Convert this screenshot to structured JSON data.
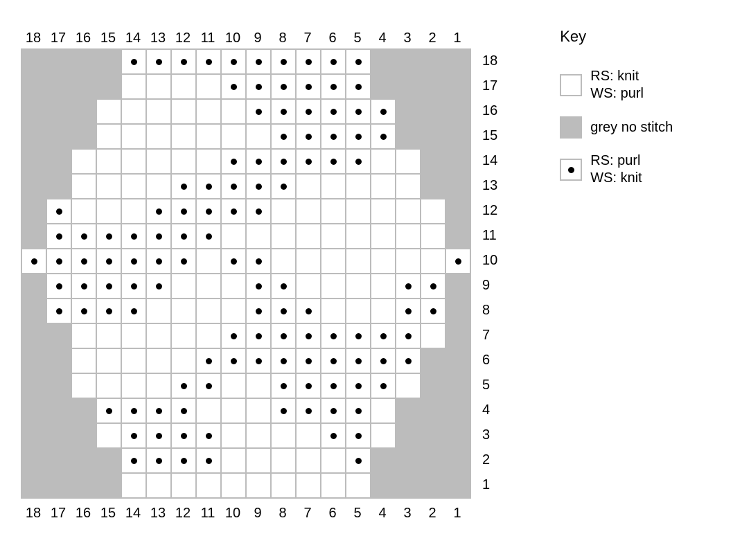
{
  "key": {
    "title": "Key",
    "items": [
      {
        "type": "knit",
        "lines": [
          "RS: knit",
          "WS: purl"
        ]
      },
      {
        "type": "nostitch",
        "lines": [
          "grey no stitch"
        ]
      },
      {
        "type": "purl",
        "lines": [
          "RS: purl",
          "WS: knit"
        ]
      }
    ]
  },
  "columns": [
    18,
    17,
    16,
    15,
    14,
    13,
    12,
    11,
    10,
    9,
    8,
    7,
    6,
    5,
    4,
    3,
    2,
    1
  ],
  "rows": [
    18,
    17,
    16,
    15,
    14,
    13,
    12,
    11,
    10,
    9,
    8,
    7,
    6,
    5,
    4,
    3,
    2,
    1
  ],
  "stitch_codes": {
    "0": "nostitch",
    "1": "knit",
    "2": "purl"
  },
  "grid": [
    [
      0,
      0,
      0,
      0,
      2,
      2,
      2,
      2,
      2,
      2,
      2,
      2,
      2,
      2,
      0,
      0,
      0,
      0
    ],
    [
      0,
      0,
      0,
      0,
      1,
      1,
      1,
      1,
      2,
      2,
      2,
      2,
      2,
      2,
      0,
      0,
      0,
      0
    ],
    [
      0,
      0,
      0,
      1,
      1,
      1,
      1,
      1,
      1,
      2,
      2,
      2,
      2,
      2,
      2,
      0,
      0,
      0
    ],
    [
      0,
      0,
      0,
      1,
      1,
      1,
      1,
      1,
      1,
      1,
      2,
      2,
      2,
      2,
      2,
      0,
      0,
      0
    ],
    [
      0,
      0,
      1,
      1,
      1,
      1,
      1,
      1,
      2,
      2,
      2,
      2,
      2,
      2,
      1,
      1,
      0,
      0
    ],
    [
      0,
      0,
      1,
      1,
      1,
      1,
      2,
      2,
      2,
      2,
      2,
      1,
      1,
      1,
      1,
      1,
      0,
      0
    ],
    [
      0,
      2,
      1,
      1,
      1,
      2,
      2,
      2,
      2,
      2,
      1,
      1,
      1,
      1,
      1,
      1,
      1,
      0
    ],
    [
      0,
      2,
      2,
      2,
      2,
      2,
      2,
      2,
      1,
      1,
      1,
      1,
      1,
      1,
      1,
      1,
      1,
      0
    ],
    [
      2,
      2,
      2,
      2,
      2,
      2,
      2,
      1,
      2,
      2,
      1,
      1,
      1,
      1,
      1,
      1,
      1,
      2
    ],
    [
      0,
      2,
      2,
      2,
      2,
      2,
      1,
      1,
      1,
      2,
      2,
      1,
      1,
      1,
      1,
      2,
      2,
      0
    ],
    [
      0,
      2,
      2,
      2,
      2,
      1,
      1,
      1,
      1,
      2,
      2,
      2,
      1,
      1,
      1,
      2,
      2,
      0
    ],
    [
      0,
      0,
      1,
      1,
      1,
      1,
      1,
      1,
      2,
      2,
      2,
      2,
      2,
      2,
      2,
      2,
      1,
      0
    ],
    [
      0,
      0,
      1,
      1,
      1,
      1,
      1,
      2,
      2,
      2,
      2,
      2,
      2,
      2,
      2,
      2,
      0,
      0
    ],
    [
      0,
      0,
      1,
      1,
      1,
      1,
      2,
      2,
      1,
      1,
      2,
      2,
      2,
      2,
      2,
      1,
      0,
      0
    ],
    [
      0,
      0,
      0,
      2,
      2,
      2,
      2,
      1,
      1,
      1,
      2,
      2,
      2,
      2,
      1,
      0,
      0,
      0
    ],
    [
      0,
      0,
      0,
      1,
      2,
      2,
      2,
      2,
      1,
      1,
      1,
      1,
      2,
      2,
      1,
      0,
      0,
      0
    ],
    [
      0,
      0,
      0,
      0,
      2,
      2,
      2,
      2,
      1,
      1,
      1,
      1,
      1,
      2,
      0,
      0,
      0,
      0
    ],
    [
      0,
      0,
      0,
      0,
      1,
      1,
      1,
      1,
      1,
      1,
      1,
      1,
      1,
      1,
      0,
      0,
      0,
      0
    ]
  ]
}
